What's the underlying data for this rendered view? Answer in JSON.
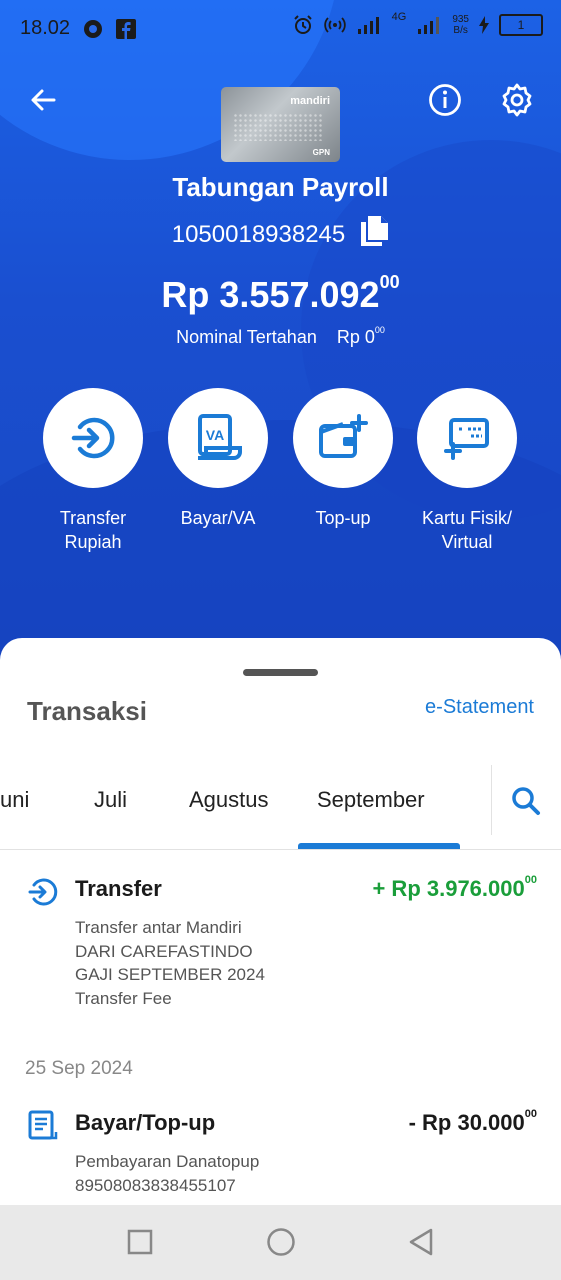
{
  "status_bar": {
    "time": "18.02",
    "network_label": "4G",
    "speed_value": "935",
    "speed_unit": "B/s",
    "battery": "1"
  },
  "account": {
    "card_brand": "mandiri",
    "card_network": "GPN",
    "name": "Tabungan Payroll",
    "number": "1050018938245",
    "balance_main": "Rp 3.557.092",
    "balance_cents": "00",
    "held_label": "Nominal Tertahan",
    "held_main": "Rp 0",
    "held_cents": "00"
  },
  "actions": [
    {
      "label_line1": "Transfer",
      "label_line2": "Rupiah",
      "icon": "transfer-icon"
    },
    {
      "label_line1": "Bayar/VA",
      "label_line2": "",
      "icon": "va-icon"
    },
    {
      "label_line1": "Top-up",
      "label_line2": "",
      "icon": "topup-wallet-icon"
    },
    {
      "label_line1": "Kartu Fisik/",
      "label_line2": "Virtual",
      "icon": "card-icon"
    }
  ],
  "transactions_section": {
    "title": "Transaksi",
    "estatement_label": "e-Statement",
    "months": [
      "uni",
      "Juli",
      "Agustus",
      "September"
    ],
    "selected_month": "September"
  },
  "transactions": [
    {
      "type": "Transfer",
      "amount_main": "+ Rp 3.976.000",
      "amount_cents": "00",
      "amount_color": "#1a9e3a",
      "desc_lines": [
        "Transfer antar Mandiri",
        "DARI CAREFASTINDO",
        "GAJI SEPTEMBER 2024",
        "Transfer Fee"
      ]
    },
    {
      "date_header": "25 Sep 2024",
      "type": "Bayar/Top-up",
      "amount_main": "- Rp 30.000",
      "amount_cents": "00",
      "amount_color": "#1a1a1a",
      "desc_lines": [
        "Pembayaran Danatopup",
        "89508083838455107"
      ]
    }
  ],
  "colors": {
    "primary_blue": "#1a4fc7",
    "accent_blue": "#1b7bd6",
    "credit_green": "#1a9e3a"
  }
}
